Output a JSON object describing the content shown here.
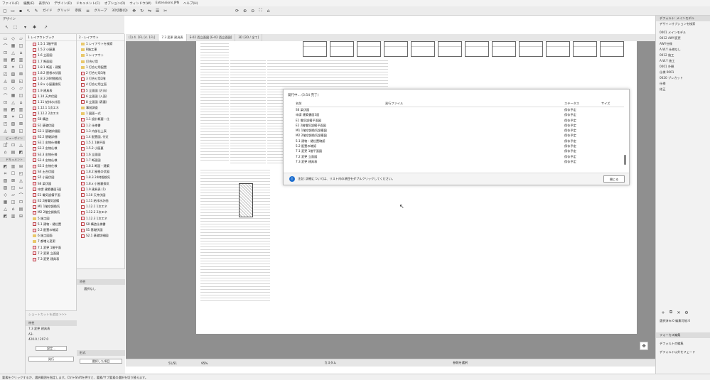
{
  "menu": [
    "ファイル(F)",
    "編集(E)",
    "表示(V)",
    "デザイン(D)",
    "ドキュメント(C)",
    "オプション(O)",
    "ウィンドウ(W)",
    "Extensions JPN",
    "ヘルプ(H)"
  ],
  "toolbar": {
    "guide": "ガイド",
    "grid": "グリッド",
    "ref": "参照",
    "group": "グループ",
    "view3d": "3D切替(Q)"
  },
  "infobox": {
    "design": "デザイン",
    "document": "ドキュメント",
    "view_point": "ビューポイント"
  },
  "nav_left": [
    "1.5.1 1階平面",
    "1.5.2 小屋裏",
    "1.6 立面図",
    "1.7 断面図",
    "1.8.1 断面・建築",
    "1.8.2 屋根の伏図",
    "1.8.3 24時間換気",
    "1.8.x 小屋裏換気",
    "1.9 建具表",
    "1.10 天井伏図",
    "1.11 給排水計画",
    "1.12.1 1次エネ",
    "1.12.2 2次エネ",
    "S0 構造",
    "S1 基礎伏図",
    "S2.1 基礎詳細図",
    "S2.2 基礎詳細",
    "S3.1 金物仕様書",
    "S3.2 金物仕様",
    "S3.3 金物仕様",
    "S3.4 金物仕様",
    "S3.5 金物仕様",
    "S4 土台伏図",
    "S5 小屋伏図",
    "S6 梁伏図",
    "申請 建築書面3面",
    "E1 電気設備平面",
    "E2 2階電気設備",
    "M1 1階空調換気",
    "M2 2階空調換気",
    "5 施工図",
    "5.1 建物・樋位置",
    "5.2 配置の確認",
    "6 施工図面",
    "7 都増え変更",
    "7.1 変更 1階平面",
    "7.2 変更 立面図",
    "7.3 変更 建具表"
  ],
  "nav_right": [
    "1 レイアウトを検索",
    "B施工事",
    "1 レイアウト",
    "打合せ用",
    "1 打合せ用配置",
    "2 打合せ用1階",
    "3 打合せ用2階",
    "4 打合せ用立面",
    "5 立面図 (方向)",
    "6 立面図 (入面)",
    "8 立面図 (表裏)",
    "事前調査",
    "1 図面一式",
    "1.1 設計概要・仕",
    "1.2 仕様書",
    "1.3 内部仕上表",
    "1.4 配置図, 付近",
    "1.5.1 1階平面",
    "1.5.2 小屋裏",
    "1.6 立面図",
    "1.7 断面図",
    "1.8.1 断面・建築",
    "1.8.2 屋根の伏図",
    "1.8.3 24時間換気",
    "1.8.x 小屋裏換気",
    "1.9 建具表 (1)",
    "1.10 天井伏図",
    "1.11 給排水計画",
    "1.12.1 1次エネ",
    "1.12.2 2次エネ",
    "1.12.3 1次エネ",
    "S0 構造仕様書",
    "S1 基礎伏図",
    "S2.1 基礎詳細図"
  ],
  "nav_right_title": "2 - レイアウト",
  "nav_left_title": "1 レイアウトブック",
  "tabs": [
    "(1) 4. 1FL [4. 1FL]",
    "7.3 変更 建具表",
    "E-02 西立面図 [E-02 西立面図]",
    "3D [3D / 全て]"
  ],
  "dialog": {
    "title": "発行中... (3:54 完了)",
    "col_name": "名前",
    "col_file": "発行ファイル",
    "col_status": "ステータス",
    "col_size": "サイズ",
    "rows": [
      {
        "name": "S6 梁伏図",
        "status": "保存予定"
      },
      {
        "name": "申請 建築書面3面",
        "status": "保存予定"
      },
      {
        "name": "E1 電気設備平面図",
        "status": "保存予定"
      },
      {
        "name": "E2 2階電気設備平面図",
        "status": "保存予定"
      },
      {
        "name": "M1 1階空調換気設備図",
        "status": "保存予定"
      },
      {
        "name": "M2 2階空調換気設備図",
        "status": "保存予定"
      },
      {
        "name": "5.1 建物・樋位置確認",
        "status": "保存予定"
      },
      {
        "name": "5.2 配置の確認",
        "status": "保存予定"
      },
      {
        "name": "7.1 変更 1階平面図",
        "status": "保存予定"
      },
      {
        "name": "7.2 変更 立面図",
        "status": "保存予定"
      },
      {
        "name": "7.3 変更 建具表",
        "status": "保存予定"
      }
    ],
    "note": "注記: 詳細については、リスト内の項目をダブルクリックしてください。",
    "close": "閉じる"
  },
  "right_panel": {
    "title": "デフォルト: メインモデル",
    "search": "デザインオプションを検索",
    "rows": [
      "0001 メインモデル",
      "0012 AWY変更",
      "AWY仕様",
      "A.W.Y 仕様なし",
      "0012 施工",
      "A.W.Y 施工",
      "0001 外観",
      "仕様 0001",
      "0020 プレカット",
      "仕様",
      "修正"
    ]
  },
  "right_bottom": {
    "sel": "選択済み:0 編集可能:0",
    "focus": "フォーカス編集",
    "default_edit": "デフォルトの編集",
    "default_focus": "デフォルト以外をフェード",
    "brand": "GRAPHISOFT"
  },
  "left_bottom": {
    "shortcut": "ショートカットを追加 >>>",
    "props": "特性",
    "item1": "7.3 変更 建具表",
    "item2": "A3-",
    "size": "420.0 / 297.0",
    "settings": "設定...",
    "publish": "発行",
    "props2": "特性",
    "none": "選択なし",
    "format": "形式",
    "selected": "選択した項目"
  },
  "bottombar": {
    "page": "51/51",
    "zoom": "95%",
    "custom": "カスタム",
    "ref": "参照を選択"
  },
  "status": "要素をクリックするか、選択範囲を指定します。Ctrl+Shiftを押すと、要素/サブ要素の選択を切り替えます。"
}
